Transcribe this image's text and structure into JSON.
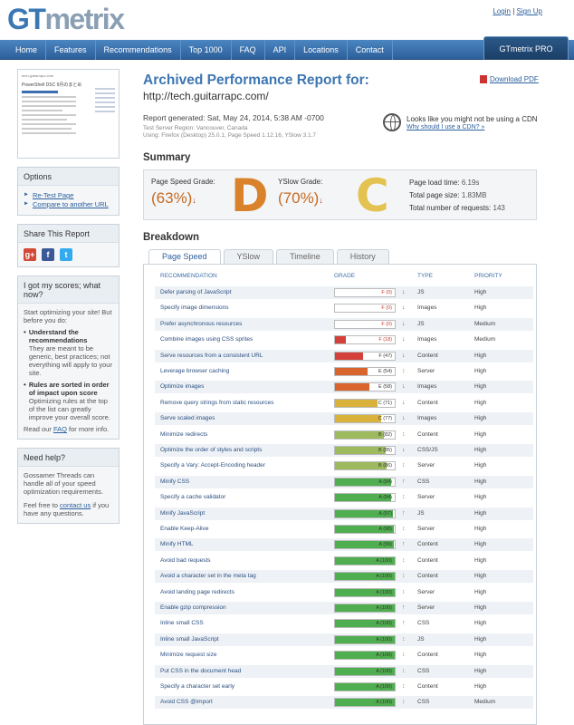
{
  "header": {
    "logo_gt": "GT",
    "logo_metrix": "metrix",
    "login": "Login",
    "separator": "|",
    "signup": "Sign Up"
  },
  "nav": {
    "items": [
      "Home",
      "Features",
      "Recommendations",
      "Top 1000",
      "FAQ",
      "API",
      "Locations",
      "Contact"
    ],
    "pro": "GTmetrix PRO"
  },
  "thumbnail": {
    "site": "tech.guitarrapc.com",
    "heading": "PowerShell DSC 9月のまとめ"
  },
  "options": {
    "title": "Options",
    "links": [
      "Re-Test Page",
      "Compare to another URL"
    ]
  },
  "share": {
    "title": "Share This Report"
  },
  "scores_help": {
    "title": "I got my scores; what now?",
    "intro": "Start optimizing your site! But before you do:",
    "b1_title": "Understand the recommendations",
    "b1_text": "They are meant to be generic, best practices; not everything will apply to your site.",
    "b2_title": "Rules are sorted in order of impact upon score",
    "b2_text": "Optimizing rules at the top of the list can greatly improve your overall score.",
    "read_pre": "Read our ",
    "read_link": "FAQ",
    "read_post": " for more info."
  },
  "need_help": {
    "title": "Need help?",
    "text1": "Gossamer Threads can handle all of your speed optimization requirements.",
    "text2_pre": "Feel free to ",
    "text2_link": "contact us",
    "text2_post": " if you have any questions."
  },
  "report": {
    "title": "Archived Performance Report for:",
    "url": "http://tech.guitarrapc.com/",
    "download": "Download PDF",
    "generated": "Report generated: Sat, May 24, 2014, 5:38 AM -0700",
    "region": "Test Server Region: Vancouver, Canada",
    "using": "Using: Firefox (Desktop) 25.0.1, Page Speed 1.12.16, YSlow 3.1.7",
    "cdn_title": "Looks like you might not be using a CDN",
    "cdn_link": "Why should I use a CDN? »"
  },
  "summary": {
    "heading": "Summary",
    "ps_label": "Page Speed Grade:",
    "ps_value": "(63%)",
    "ps_letter": "D",
    "ys_label": "YSlow Grade:",
    "ys_value": "(70%)",
    "ys_letter": "C",
    "load_label": "Page load time:",
    "load_value": "6.19s",
    "size_label": "Total page size:",
    "size_value": "1.83MB",
    "req_label": "Total number of requests:",
    "req_value": "143",
    "colors": {
      "D": "#d9822b",
      "C": "#e3c24f"
    }
  },
  "breakdown": {
    "heading": "Breakdown",
    "tabs": [
      "Page Speed",
      "YSlow",
      "Timeline",
      "History"
    ],
    "columns": [
      "RECOMMENDATION",
      "GRADE",
      "TYPE",
      "PRIORITY"
    ],
    "rows": [
      {
        "name": "Defer parsing of JavaScript",
        "grade": "F (0)",
        "score": 0,
        "dir": "down",
        "type": "JS",
        "priority": "High"
      },
      {
        "name": "Specify image dimensions",
        "grade": "F (0)",
        "score": 0,
        "dir": "down",
        "type": "Images",
        "priority": "High"
      },
      {
        "name": "Prefer asynchronous resources",
        "grade": "F (0)",
        "score": 0,
        "dir": "down",
        "type": "JS",
        "priority": "Medium"
      },
      {
        "name": "Combine images using CSS sprites",
        "grade": "F (18)",
        "score": 18,
        "dir": "down",
        "type": "Images",
        "priority": "Medium"
      },
      {
        "name": "Serve resources from a consistent URL",
        "grade": "F (47)",
        "score": 47,
        "dir": "down",
        "type": "Content",
        "priority": "High"
      },
      {
        "name": "Leverage browser caching",
        "grade": "E (54)",
        "score": 54,
        "dir": "updown",
        "type": "Server",
        "priority": "High"
      },
      {
        "name": "Optimize images",
        "grade": "E (58)",
        "score": 58,
        "dir": "down",
        "type": "Images",
        "priority": "High"
      },
      {
        "name": "Remove query strings from static resources",
        "grade": "C (71)",
        "score": 71,
        "dir": "down",
        "type": "Content",
        "priority": "High"
      },
      {
        "name": "Serve scaled images",
        "grade": "C (77)",
        "score": 77,
        "dir": "down",
        "type": "Images",
        "priority": "High"
      },
      {
        "name": "Minimize redirects",
        "grade": "B (82)",
        "score": 82,
        "dir": "updown",
        "type": "Content",
        "priority": "High"
      },
      {
        "name": "Optimize the order of styles and scripts",
        "grade": "B (85)",
        "score": 85,
        "dir": "down",
        "type": "CSS/JS",
        "priority": "High"
      },
      {
        "name": "Specify a Vary: Accept-Encoding header",
        "grade": "B (86)",
        "score": 86,
        "dir": "updown",
        "type": "Server",
        "priority": "High"
      },
      {
        "name": "Minify CSS",
        "grade": "A (94)",
        "score": 94,
        "dir": "up",
        "type": "CSS",
        "priority": "High"
      },
      {
        "name": "Specify a cache validator",
        "grade": "A (94)",
        "score": 94,
        "dir": "updown",
        "type": "Server",
        "priority": "High"
      },
      {
        "name": "Minify JavaScript",
        "grade": "A (97)",
        "score": 97,
        "dir": "up",
        "type": "JS",
        "priority": "High"
      },
      {
        "name": "Enable Keep-Alive",
        "grade": "A (98)",
        "score": 98,
        "dir": "updown",
        "type": "Server",
        "priority": "High"
      },
      {
        "name": "Minify HTML",
        "grade": "A (99)",
        "score": 99,
        "dir": "up",
        "type": "Content",
        "priority": "High"
      },
      {
        "name": "Avoid bad requests",
        "grade": "A (100)",
        "score": 100,
        "dir": "updown",
        "type": "Content",
        "priority": "High"
      },
      {
        "name": "Avoid a character set in the meta tag",
        "grade": "A (100)",
        "score": 100,
        "dir": "updown",
        "type": "Content",
        "priority": "High"
      },
      {
        "name": "Avoid landing page redirects",
        "grade": "A (100)",
        "score": 100,
        "dir": "updown",
        "type": "Server",
        "priority": "High"
      },
      {
        "name": "Enable gzip compression",
        "grade": "A (100)",
        "score": 100,
        "dir": "up",
        "type": "Server",
        "priority": "High"
      },
      {
        "name": "Inline small CSS",
        "grade": "A (100)",
        "score": 100,
        "dir": "up",
        "type": "CSS",
        "priority": "High"
      },
      {
        "name": "Inline small JavaScript",
        "grade": "A (100)",
        "score": 100,
        "dir": "updown",
        "type": "JS",
        "priority": "High"
      },
      {
        "name": "Minimize request size",
        "grade": "A (100)",
        "score": 100,
        "dir": "updown",
        "type": "Content",
        "priority": "High"
      },
      {
        "name": "Put CSS in the document head",
        "grade": "A (100)",
        "score": 100,
        "dir": "updown",
        "type": "CSS",
        "priority": "High"
      },
      {
        "name": "Specify a character set early",
        "grade": "A (100)",
        "score": 100,
        "dir": "updown",
        "type": "Content",
        "priority": "High"
      },
      {
        "name": "Avoid CSS @import",
        "grade": "A (100)",
        "score": 100,
        "dir": "updown",
        "type": "CSS",
        "priority": "Medium"
      }
    ]
  }
}
